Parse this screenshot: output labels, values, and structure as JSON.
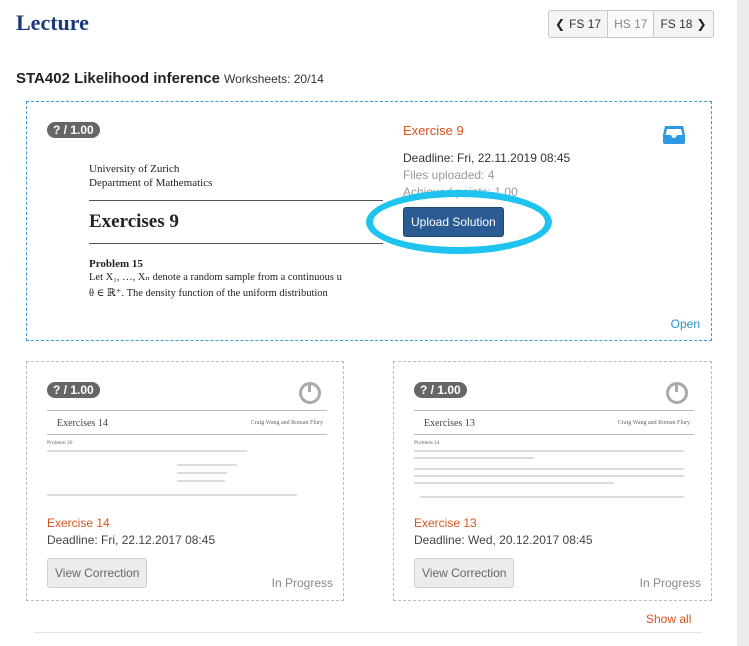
{
  "header": {
    "title": "Lecture",
    "semesters": {
      "prev_icon": "chevron-left-icon",
      "items": [
        "FS 17",
        "HS 17",
        "FS 18"
      ],
      "next_icon": "chevron-right-icon"
    }
  },
  "course": {
    "title": "STA402 Likelihood inference",
    "worksheets": "Worksheets: 20/14"
  },
  "main_card": {
    "score": "? / 1.00",
    "exercise": "Exercise 9",
    "deadline": "Deadline: Fri, 22.11.2019 08:45",
    "files_uploaded": "Files uploaded: 4",
    "achieved": "Achieved points: 1.00",
    "upload_label": "Upload Solution",
    "open_label": "Open",
    "icon": "inbox-tray-icon",
    "highlight_color": "#1fc3f0",
    "doc": {
      "institution_1": "University of Zurich",
      "institution_2": "Department of Mathematics",
      "heading": "Exercises 9",
      "problem": "Problem 15",
      "line_1": "Let X₁, …, Xₙ denote a random sample from a continuous u",
      "line_2": "θ ∈ ℝ⁺.  The density function of the uniform distribution"
    }
  },
  "cards": [
    {
      "score": "? / 1.00",
      "exercise": "Exercise 14",
      "deadline": "Deadline: Fri, 22.12.2017 08:45",
      "button": "View Correction",
      "status": "In Progress",
      "thumb": {
        "title": "Exercises 14",
        "authors": "Craig Wang and Roman Flury",
        "problem": "Problem 26"
      }
    },
    {
      "score": "? / 1.00",
      "exercise": "Exercise 13",
      "deadline": "Deadline: Wed, 20.12.2017 08:45",
      "button": "View Correction",
      "status": "In Progress",
      "thumb": {
        "title": "Exercises 13",
        "authors": "Craig Wang and Roman Flury",
        "problem": "Problem 24"
      }
    }
  ],
  "footer": {
    "show_all": "Show all"
  }
}
